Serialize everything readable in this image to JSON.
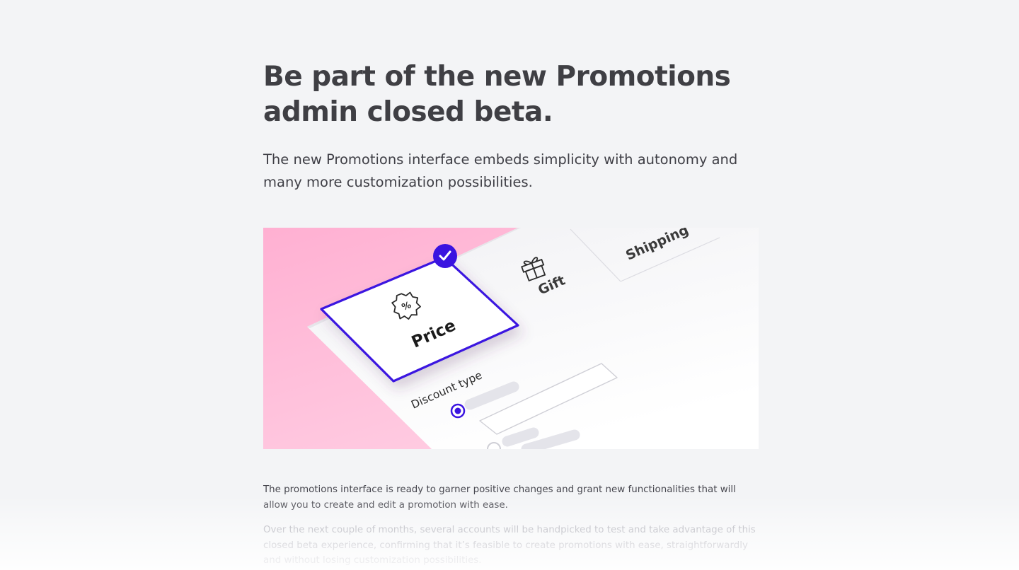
{
  "headline": "Be part of the new Promotions admin closed beta.",
  "subtitle": "The new Promotions interface embeds simplicity with autonomy and many more customization possibilities.",
  "illustration": {
    "cards": {
      "price": "Price",
      "gift": "Gift",
      "shipping": "Shipping"
    },
    "form_label": "Discount type",
    "selected_badge_icon": "check-icon",
    "icons": {
      "price": "percent-badge-icon",
      "gift": "gift-icon"
    },
    "colors": {
      "background_pink": "#ffb3d5",
      "accent_purple": "#3a14e0",
      "card_white": "#ffffff"
    }
  },
  "paragraphs": [
    "The promotions interface is ready to garner positive changes and grant new functionalities that will allow you to create and edit a promotion with ease.",
    "Over the next couple of months, several accounts will be handpicked to test and take advantage of this closed beta experience, confirming that it’s feasible to create promotions with ease, straightforwardly and without losing customization possibilities."
  ]
}
